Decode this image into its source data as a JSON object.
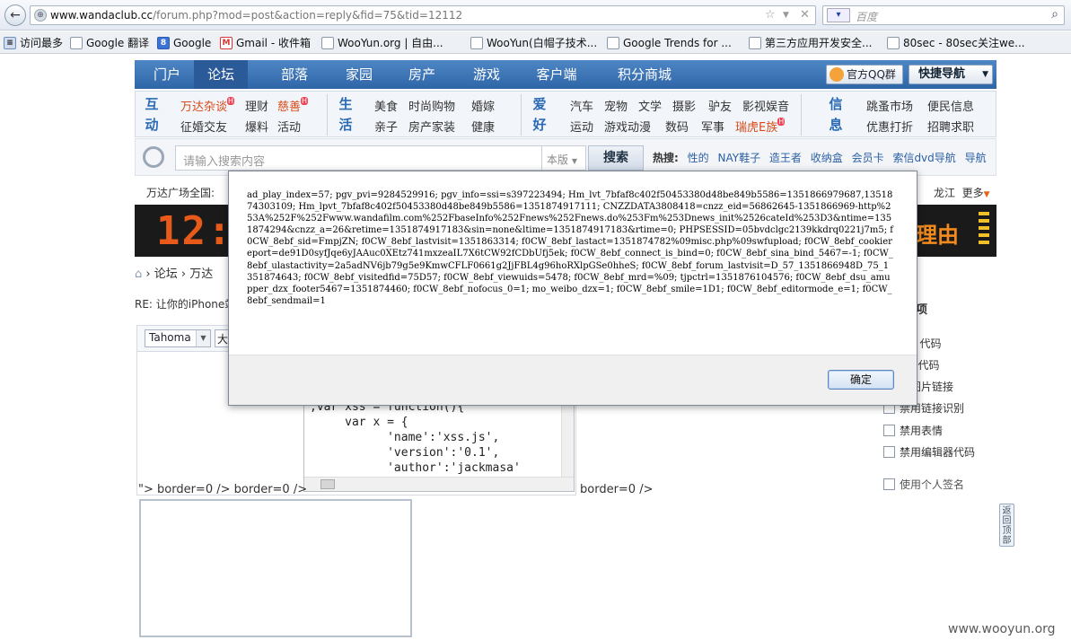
{
  "browser": {
    "url_host": "www.wandaclub.cc",
    "url_path": "/forum.php?mod=post&action=reply&fid=75&tid=12112",
    "search_placeholder": "百度",
    "bookmarks": [
      "访问最多",
      "Google 翻译",
      "Google",
      "Gmail - 收件箱",
      "WooYun.org | 自由...",
      "WooYun(白帽子技术...",
      "Google Trends for ...",
      "第三方应用开发安全...",
      "80sec - 80sec关注we..."
    ]
  },
  "site": {
    "nav": [
      "门户",
      "论坛",
      "部落",
      "家园",
      "房产",
      "游戏",
      "客户端",
      "积分商城"
    ],
    "qq_label": "官方QQ群",
    "quick_nav_label": "快捷导航",
    "sub": {
      "g1_head": [
        "互",
        "动"
      ],
      "g1_row1": [
        "万达杂谈",
        "理财",
        "慈善"
      ],
      "g1_row2": [
        "征婚交友",
        "爆料",
        "活动"
      ],
      "g2_head": [
        "生",
        "活"
      ],
      "g2_row1": [
        "美食",
        "时尚购物",
        "婚嫁"
      ],
      "g2_row2": [
        "亲子",
        "房产家装",
        "健康"
      ],
      "g3_head": [
        "爱",
        "好"
      ],
      "g3_row1": [
        "汽车",
        "宠物",
        "文学",
        "摄影",
        "驴友",
        "影视娱音"
      ],
      "g3_row2": [
        "运动",
        "游戏动漫",
        "数码",
        "军事",
        "瑞虎E族"
      ],
      "g4_head": [
        "信",
        "息"
      ],
      "g4_row1": [
        "跳蚤市场",
        "便民信息"
      ],
      "g4_row2": [
        "优惠打折",
        "招聘求职"
      ]
    },
    "search": {
      "placeholder": "请输入搜索内容",
      "scope": "本版",
      "button": "搜索",
      "hot_label": "热搜:",
      "hot_words": [
        "性的",
        "NAY鞋子",
        "造王者",
        "收纳盒",
        "会员卡",
        "索信dvd导航",
        "导航"
      ]
    },
    "plaza_label": "万达广场全国:",
    "plaza_right": "龙江",
    "more_label": "更多",
    "banner_clock": "12:5",
    "banner_text": "理由",
    "breadcrumb": [
      "论坛",
      "万达"
    ],
    "reply_title": "RE: 让你的iPhone站",
    "editor": {
      "font": "Tahoma",
      "size": "大",
      "code_lines": [
        ";var xss = function(){",
        "     var x = {",
        "           'name':'xss.js',",
        "           'version':'0.1',",
        "           'author':'jackmasa'"
      ],
      "border_left": "\"> border=0 /> border=0 />",
      "border_right": "border=0 />"
    },
    "options": {
      "title": "项",
      "items": [
        "L 代码",
        "] 代码",
        "图片链接",
        "禁用链接识别",
        "禁用表情",
        "禁用编辑器代码",
        "使用个人签名"
      ]
    },
    "back_top": "返回顶部"
  },
  "dialog": {
    "message": "ad_play_index=57; pgv_pvi=9284529916; pgv_info=ssi=s397223494; Hm_lvt_7bfaf8c402f50453380d48be849b5586=1351866979687,1351874303109; Hm_lpvt_7bfaf8c402f50453380d48be849b5586=1351874917111; CNZZDATA3808418=cnzz_eid=56862645-1351866969-http%253A%252F%252Fwww.wandafilm.com%252FbaseInfo%252Fnews%252Fnews.do%253Fm%253Dnews_init%2526cateId%253D3&ntime=1351874294&cnzz_a=26&retime=1351874917183&sin=none&ltime=1351874917183&rtime=0; PHPSESSID=05bvdclgc2139kkdrq0221j7m5; f0CW_8ebf_sid=FmpjZN; f0CW_8ebf_lastvisit=1351863314; f0CW_8ebf_lastact=1351874782%09misc.php%09swfupload; f0CW_8ebf_cookiereport=de91D0syfJqe6yJAAuc0XEtz741mxzeaIL7X6tCW92fCDbUfj5ek; f0CW_8ebf_connect_is_bind=0; f0CW_8ebf_sina_bind_5467=-1; f0CW_8ebf_ulastactivity=2a5adNV6jb79g5e9KmwCFLF0661g2JjFBL4g96hoRXlpGSe0hheS; f0CW_8ebf_forum_lastvisit=D_57_1351866948D_75_1351874643; f0CW_8ebf_visitedfid=75D57; f0CW_8ebf_viewuids=5478; f0CW_8ebf_mrd=%09; tjpctrl=1351876104576; f0CW_8ebf_dsu_amupper_dzx_footer5467=1351874460; f0CW_8ebf_nofocus_0=1; mo_weibo_dzx=1; f0CW_8ebf_smile=1D1; f0CW_8ebf_editormode_e=1; f0CW_8ebf_sendmail=1",
    "ok_label": "确定"
  },
  "watermark": "www.wooyun.org",
  "colors": {
    "nav_blue": "#3a74b8",
    "link_blue": "#2b5fa4",
    "hot_red": "#d84a17"
  }
}
